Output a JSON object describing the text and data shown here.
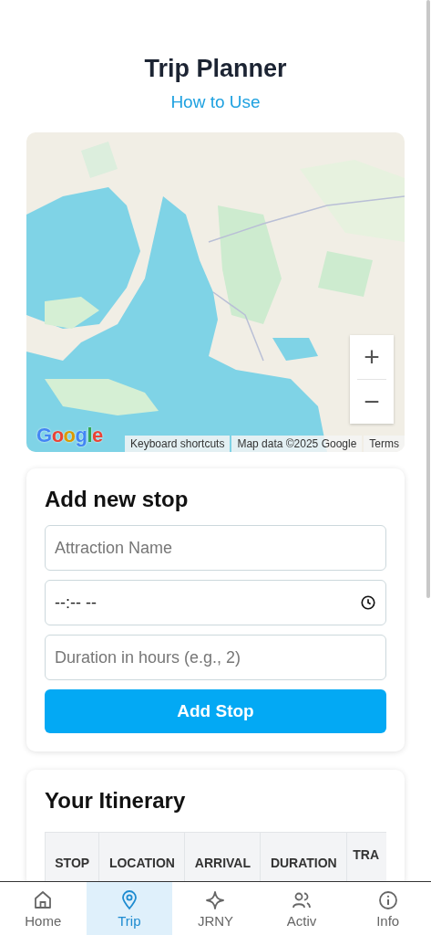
{
  "header": {
    "title": "Trip Planner",
    "link": "How to Use"
  },
  "map": {
    "kind": "picture",
    "zoom_in": "+",
    "zoom_out": "−",
    "logo": "Google",
    "attribution": [
      "Keyboard shortcuts",
      "Map data ©2025 Google",
      "Terms"
    ]
  },
  "add_stop": {
    "title": "Add new stop",
    "name_field": {
      "placeholder": "Attraction Name"
    },
    "time_field": {
      "value": "--:-- --"
    },
    "duration_field": {
      "placeholder": "Duration in hours (e.g., 2)"
    },
    "button": "Add Stop"
  },
  "itinerary": {
    "title": "Your Itinerary",
    "columns": [
      "STOP",
      "LOCATION",
      "ARRIVAL",
      "DURATION",
      "TRA"
    ]
  },
  "nav": [
    {
      "label": "Home",
      "selected": false
    },
    {
      "label": "Trip",
      "selected": true
    },
    {
      "label": "JRNY",
      "selected": false
    },
    {
      "label": "Activ",
      "selected": false
    },
    {
      "label": "Info",
      "selected": false
    }
  ]
}
